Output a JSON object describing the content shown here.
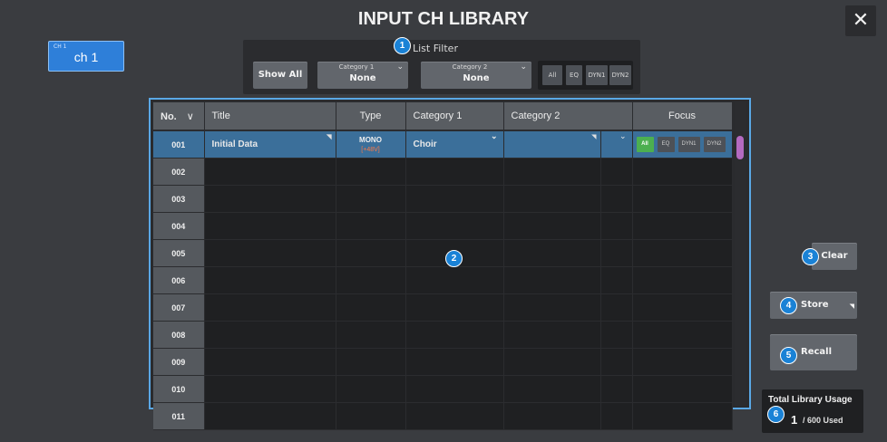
{
  "window": {
    "title": "INPUT CH LIBRARY",
    "close_icon": "✕"
  },
  "channel": {
    "small_label": "CH 1",
    "label": "ch 1"
  },
  "filter": {
    "label": "List Filter",
    "show_all": "Show All",
    "category1": {
      "caption": "Category 1",
      "value": "None"
    },
    "category2": {
      "caption": "Category 2",
      "value": "None"
    },
    "focus": [
      "All",
      "EQ",
      "DYN1",
      "DYN2"
    ]
  },
  "table": {
    "headers": {
      "no": "No.",
      "title": "Title",
      "type": "Type",
      "category1": "Category 1",
      "category2": "Category 2",
      "focus": "Focus"
    },
    "sort_chevron": "∨",
    "rows": [
      {
        "no": "001",
        "title": "Initial Data",
        "type": "MONO",
        "type_sub": "[+48V]",
        "category1": "Choir",
        "category2": "",
        "focus": [
          "All",
          "EQ",
          "DYN1",
          "DYN2"
        ]
      },
      {
        "no": "002"
      },
      {
        "no": "003"
      },
      {
        "no": "004"
      },
      {
        "no": "005"
      },
      {
        "no": "006"
      },
      {
        "no": "007"
      },
      {
        "no": "008"
      },
      {
        "no": "009"
      },
      {
        "no": "010"
      },
      {
        "no": "011"
      }
    ]
  },
  "actions": {
    "clear": "Clear",
    "store": "Store",
    "recall": "Recall"
  },
  "usage": {
    "label": "Total Library Usage",
    "count": "1",
    "total": "/ 600 Used"
  },
  "callouts": [
    "1",
    "2",
    "3",
    "4",
    "5",
    "6"
  ],
  "colors": {
    "accent": "#2e7fd9",
    "selected_row": "#3b6f9a",
    "table_border": "#5aa8e6",
    "active_focus": "#4caf50",
    "scroll_thumb": "#b46ac0",
    "phantom": "#ff7a45"
  }
}
